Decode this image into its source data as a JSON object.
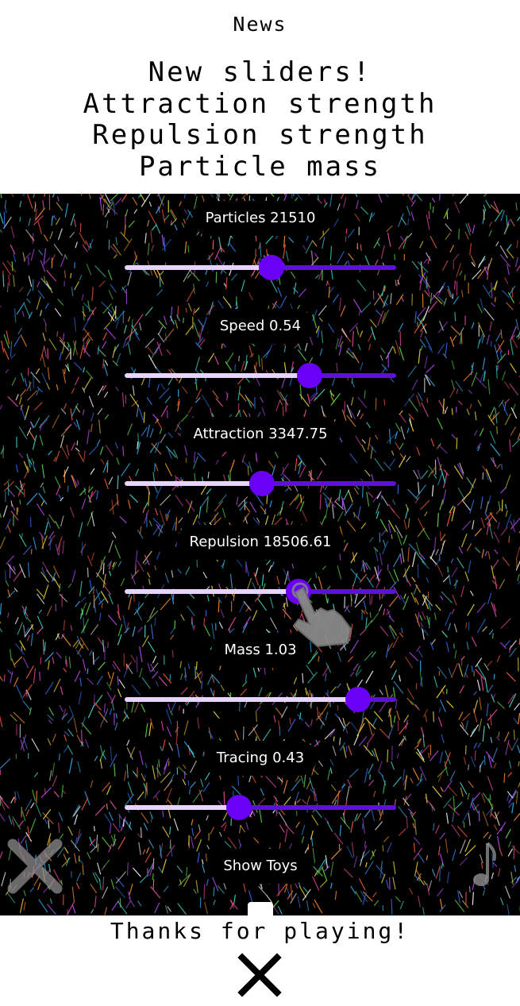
{
  "header": {
    "title": "News",
    "lines": [
      "New sliders!",
      "Attraction strength",
      "Repulsion strength",
      "Particle mass"
    ]
  },
  "sliders": [
    {
      "label": "Particles 21510",
      "fraction": 0.54
    },
    {
      "label": "Speed 0.54",
      "fraction": 0.68
    },
    {
      "label": "Attraction 3347.75",
      "fraction": 0.505
    },
    {
      "label": "Repulsion 18506.61",
      "fraction": 0.64
    },
    {
      "label": "Mass 1.03",
      "fraction": 0.86
    },
    {
      "label": "Tracing 0.43",
      "fraction": 0.42
    }
  ],
  "show_toys_label": "Show Toys",
  "footer": {
    "thanks": "Thanks for playing!"
  },
  "icons": {
    "left": "close-icon",
    "right": "music-note-icon",
    "hand": "pointing-hand-icon",
    "footer": "close-icon"
  },
  "colors": {
    "thumb": "#6a00f4",
    "track_fill": "#e6d4ff",
    "track_rest": "#5a12d8"
  }
}
